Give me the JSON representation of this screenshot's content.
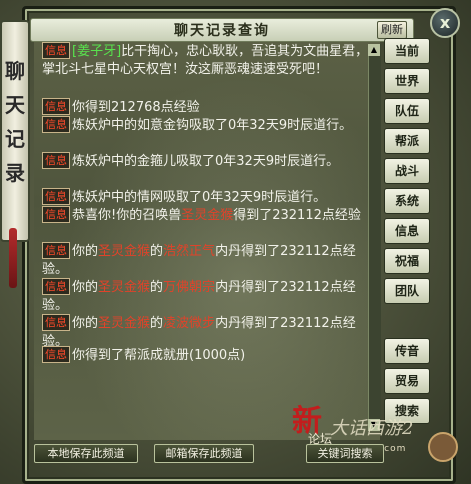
{
  "window": {
    "title": "聊天记录查询",
    "refresh_label": "刷新",
    "close_label": "x",
    "banner_text": "聊天记录"
  },
  "messages": [
    {
      "tag": "信息",
      "segments": [
        {
          "text": "[姜子牙]",
          "color": "green"
        },
        {
          "text": "比干掏心，忠心耿耿，吾追其为文曲星君，掌北斗七星中心天权宫！汝这厮恶魂速速受死吧！",
          "color": "white"
        }
      ]
    },
    {
      "tag": "信息",
      "segments": [
        {
          "text": "你得到212768点经验",
          "color": "white"
        }
      ]
    },
    {
      "tag": "信息",
      "segments": [
        {
          "text": "炼妖炉中的如意金钩吸取了0年32天9时辰道行。",
          "color": "white"
        }
      ]
    },
    {
      "tag": "信息",
      "segments": [
        {
          "text": "炼妖炉中的金箍儿吸取了0年32天9时辰道行。",
          "color": "white"
        }
      ]
    },
    {
      "tag": "信息",
      "segments": [
        {
          "text": "炼妖炉中的情网吸取了0年32天9时辰道行。",
          "color": "white"
        }
      ]
    },
    {
      "tag": "信息",
      "segments": [
        {
          "text": "恭喜你!你的召唤兽",
          "color": "white"
        },
        {
          "text": "圣灵金猴",
          "color": "red"
        },
        {
          "text": "得到了232112点经验",
          "color": "white"
        }
      ]
    },
    {
      "tag": "信息",
      "segments": [
        {
          "text": "你的",
          "color": "white"
        },
        {
          "text": "圣灵金猴",
          "color": "red"
        },
        {
          "text": "的",
          "color": "white"
        },
        {
          "text": "浩然正气",
          "color": "red"
        },
        {
          "text": "内丹得到了232112点经验。",
          "color": "white"
        }
      ]
    },
    {
      "tag": "信息",
      "segments": [
        {
          "text": "你的",
          "color": "white"
        },
        {
          "text": "圣灵金猴",
          "color": "red"
        },
        {
          "text": "的",
          "color": "white"
        },
        {
          "text": "万佛朝宗",
          "color": "red"
        },
        {
          "text": "内丹得到了232112点经验。",
          "color": "white"
        }
      ]
    },
    {
      "tag": "信息",
      "segments": [
        {
          "text": "你的",
          "color": "white"
        },
        {
          "text": "圣灵金猴",
          "color": "red"
        },
        {
          "text": "的",
          "color": "white"
        },
        {
          "text": "凌波微步",
          "color": "red"
        },
        {
          "text": "内丹得到了232112点经验。",
          "color": "white"
        }
      ]
    },
    {
      "tag": "信息",
      "segments": [
        {
          "text": "你得到了帮派成就册(1000点)",
          "color": "white"
        }
      ]
    }
  ],
  "tabs": [
    "当前",
    "世界",
    "队伍",
    "帮派",
    "战斗",
    "系统",
    "信息",
    "祝福",
    "团队",
    "传音",
    "贸易",
    "搜索"
  ],
  "bottom_buttons": [
    "本地保存此频道",
    "邮箱保存此频道",
    "关键词搜索"
  ],
  "brand": {
    "main": "新",
    "sub": "大话西游2",
    "forum": "论坛",
    "url": "xy2.netease.com"
  },
  "colors": {
    "green": "#59e34e",
    "red": "#e0432a",
    "white": "#f2f2ea"
  }
}
